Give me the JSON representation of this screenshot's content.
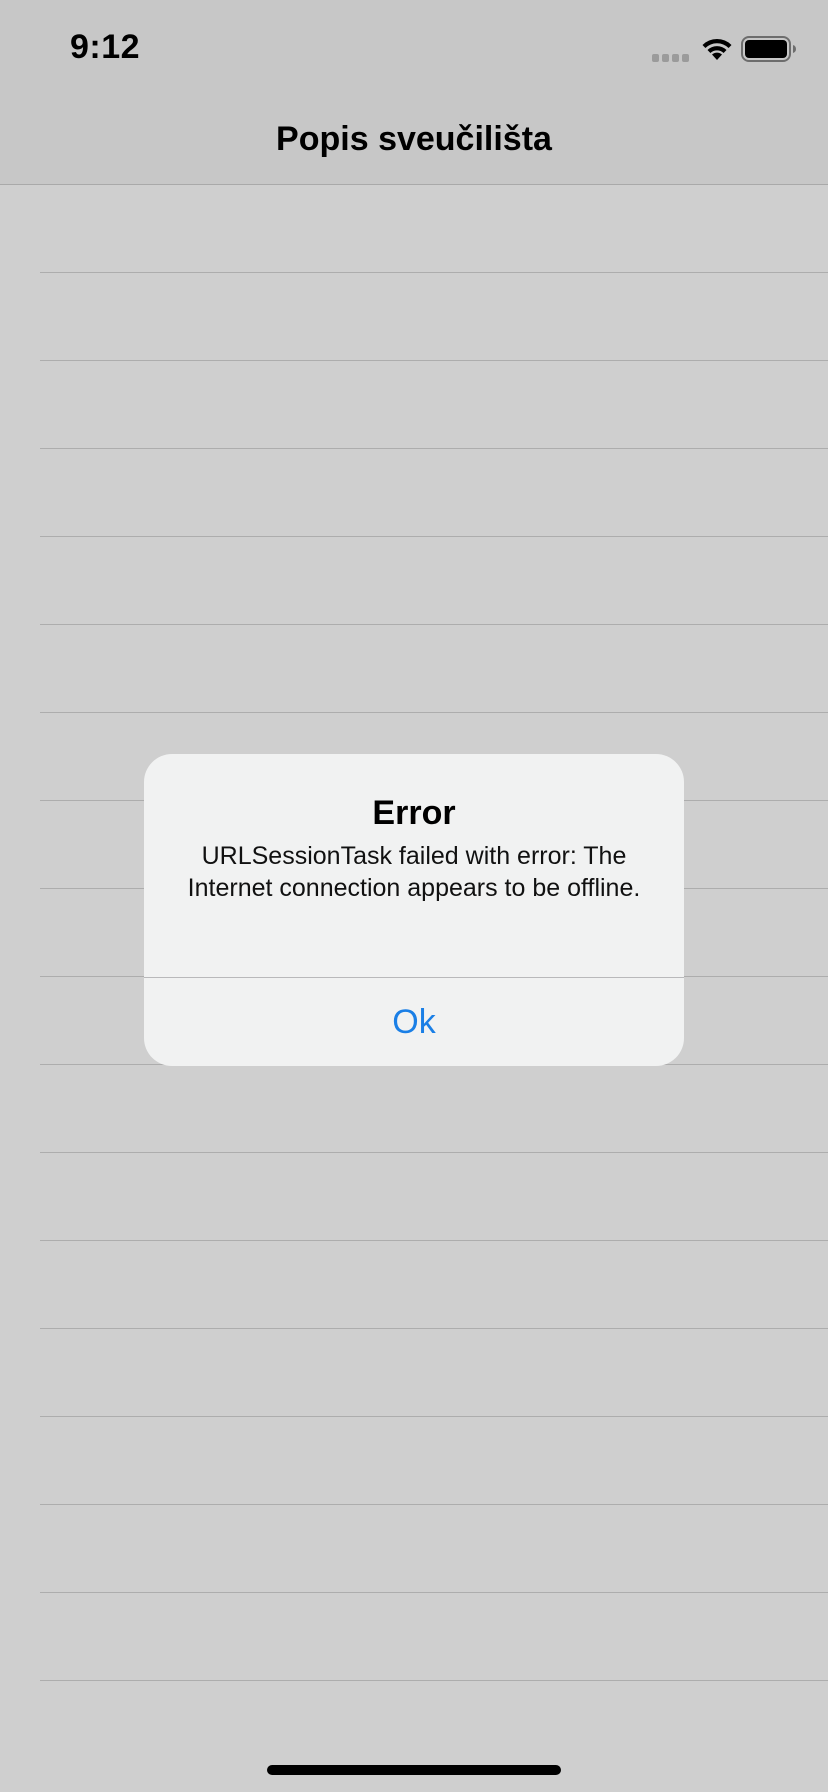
{
  "status_bar": {
    "time": "9:12",
    "signal_icon": "signal-bars-icon",
    "wifi_icon": "wifi-icon",
    "battery_icon": "battery-icon"
  },
  "nav": {
    "title": "Popis sveučilišta"
  },
  "table": {
    "row_count": 17
  },
  "alert": {
    "title": "Error",
    "message": "URLSessionTask failed with error: The Internet connection appears to be offline.",
    "ok_label": "Ok"
  },
  "colors": {
    "background": "#cfcfcf",
    "bar": "#c7c7c7",
    "alert_bg": "#f1f2f2",
    "accent": "#1a7fe6"
  }
}
